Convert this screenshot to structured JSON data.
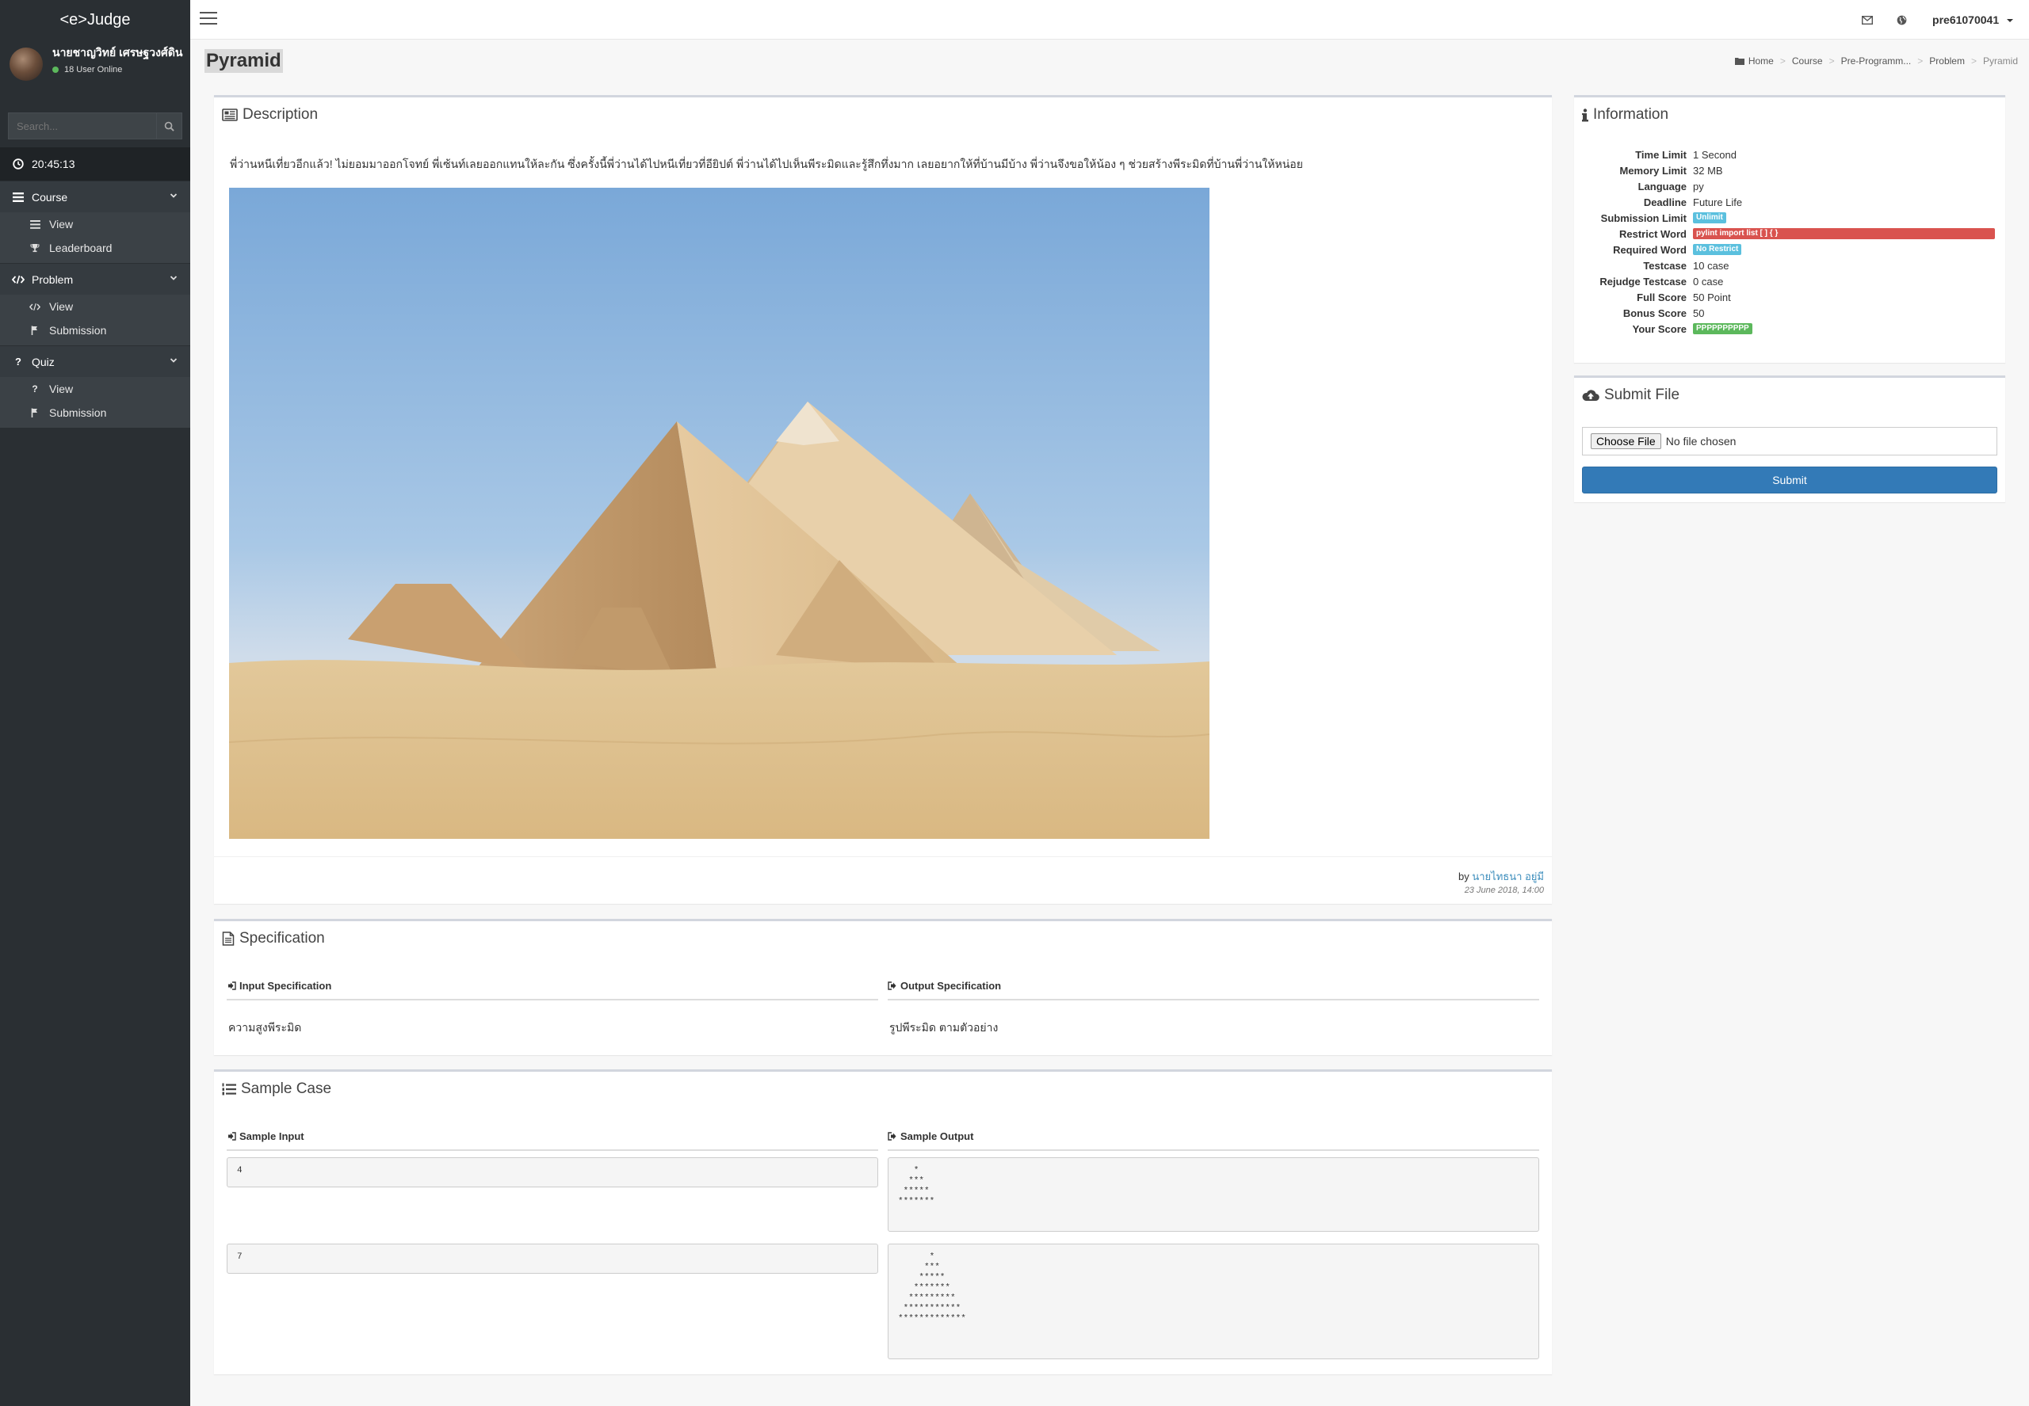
{
  "app": {
    "brand": "<e>Judge"
  },
  "user": {
    "name": "นายชาญวิทย์ เศรษฐวงศ์ดิน",
    "online": "18 User Online"
  },
  "search": {
    "placeholder": "Search..."
  },
  "clock": "20:45:13",
  "sidebar": {
    "course": {
      "label": "Course",
      "items": [
        {
          "label": "View",
          "icon": "list-icon"
        },
        {
          "label": "Leaderboard",
          "icon": "trophy-icon"
        }
      ]
    },
    "problem": {
      "label": "Problem",
      "items": [
        {
          "label": "View",
          "icon": "code-icon"
        },
        {
          "label": "Submission",
          "icon": "flag-icon"
        }
      ]
    },
    "quiz": {
      "label": "Quiz",
      "items": [
        {
          "label": "View",
          "icon": "question-icon"
        },
        {
          "label": "Submission",
          "icon": "flag-icon"
        }
      ]
    }
  },
  "topbar": {
    "username": "pre61070041"
  },
  "page": {
    "title": "Pyramid"
  },
  "breadcrumb": [
    "Home",
    "Course",
    "Pre-Programm...",
    "Problem",
    "Pyramid"
  ],
  "description": {
    "title": "Description",
    "text": "พี่ว่านหนีเที่ยวอีกแล้ว! ไม่ยอมมาออกโจทย์ พี่เซ้นท์เลยออกแทนให้ละกัน ซึ่งครั้งนี้พี่ว่านได้ไปหนีเที่ยวที่อียิปต์ พี่ว่านได้ไปเห็นพีระมิดและรู้สึกทึ่งมาก เลยอยากให้ที่บ้านมีบ้าง พี่ว่านจึงขอให้น้อง ๆ ช่วยสร้างพีระมิดที่บ้านพี่ว่านให้หน่อย",
    "by_prefix": "by",
    "author": "นายไทธนา อยู่มี",
    "date": "23 June 2018, 14:00"
  },
  "specification": {
    "title": "Specification",
    "input_head": "Input Specification",
    "output_head": "Output Specification",
    "input_text": "ความสูงพีระมิด",
    "output_text": "รูปพีระมิด ตามตัวอย่าง"
  },
  "sample": {
    "title": "Sample Case",
    "input_head": "Sample Input",
    "output_head": "Sample Output",
    "cases": [
      {
        "input": "4",
        "output": "   *\n  ***\n *****\n*******"
      },
      {
        "input": "7",
        "output": "      *\n     ***\n    *****\n   *******\n  *********\n ***********\n*************"
      }
    ]
  },
  "information": {
    "title": "Information",
    "rows": [
      {
        "label": "Time Limit",
        "value": "1 Second"
      },
      {
        "label": "Memory Limit",
        "value": "32 MB"
      },
      {
        "label": "Language",
        "value": "py"
      },
      {
        "label": "Deadline",
        "value": "Future Life"
      },
      {
        "label": "Submission Limit",
        "value": "Unlimit"
      },
      {
        "label": "Restrict Word",
        "value": "pylint import list [ ] { }"
      },
      {
        "label": "Required Word",
        "value": "No Restrict"
      },
      {
        "label": "Testcase",
        "value": "10 case"
      },
      {
        "label": "Rejudge Testcase",
        "value": "0 case"
      },
      {
        "label": "Full Score",
        "value": "50 Point"
      },
      {
        "label": "Bonus Score",
        "value": "50"
      },
      {
        "label": "Your Score",
        "value": "PPPPPPPPPP"
      }
    ]
  },
  "submit": {
    "title": "Submit File",
    "choose_label": "Choose File",
    "no_file": "No file chosen",
    "button": "Submit"
  },
  "colors": {
    "sidebar_bg": "#2a2f33",
    "primary": "#337ab7",
    "info": "#5bc0de",
    "danger": "#d9534f",
    "success": "#5cb85c",
    "link": "#3c8dbc"
  }
}
